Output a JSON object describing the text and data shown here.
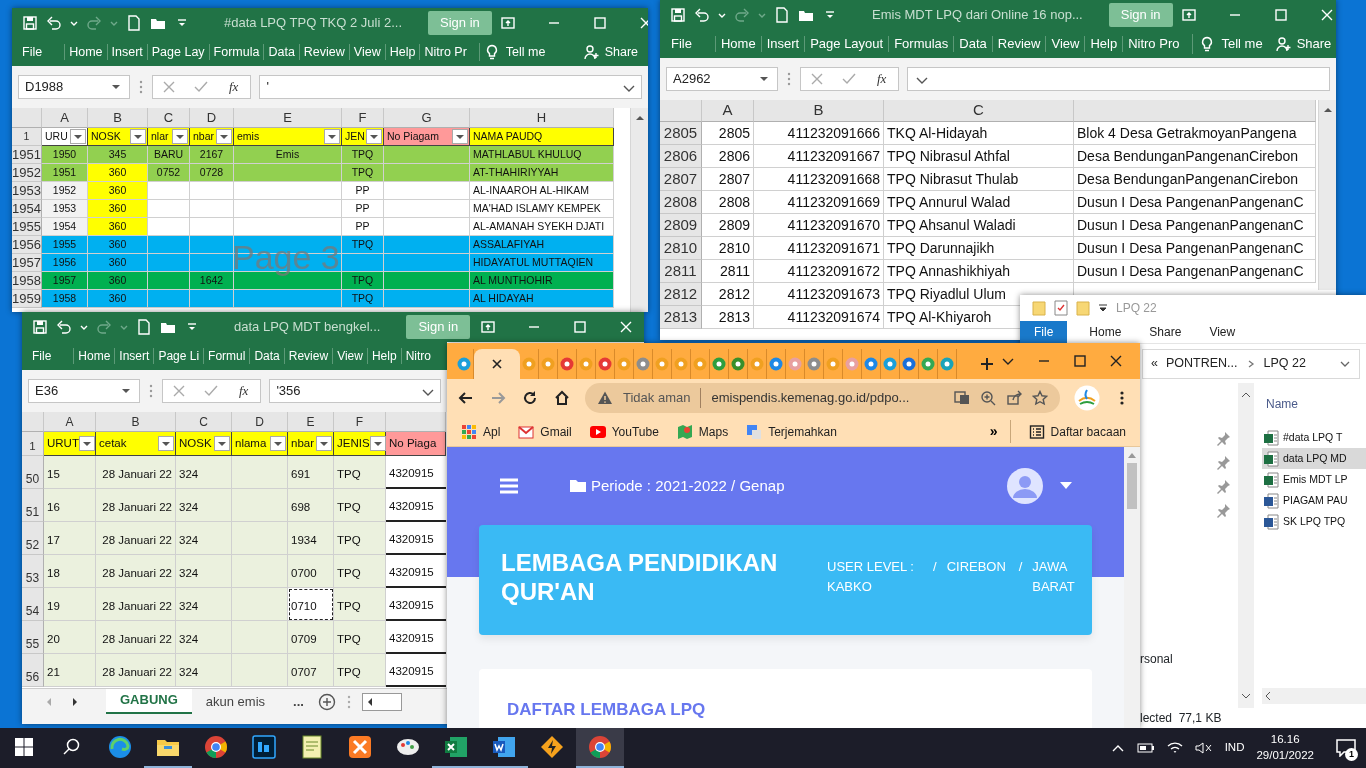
{
  "excel_windows": [
    {
      "title": "#data LPQ TPQ TKQ 2 Juli 2...",
      "sign_in": "Sign in",
      "ribbon_tabs": [
        "File",
        "Home",
        "Insert",
        "Page Lay",
        "Formula",
        "Data",
        "Review",
        "View",
        "Help",
        "Nitro Pr"
      ],
      "tell_me": "Tell me",
      "share": "Share",
      "name_box": "D1988",
      "function_button": "fx",
      "formula": "'",
      "columns": [
        "A",
        "B",
        "C",
        "D",
        "E",
        "F",
        "G",
        "H"
      ],
      "header": {
        "number": "1",
        "cells": [
          {
            "text": "URU",
            "color": "#ffffff",
            "filter": true
          },
          {
            "text": "NOSK",
            "color": "#ffff00",
            "filter": true
          },
          {
            "text": "nlar",
            "color": "#ffff00",
            "filter": true
          },
          {
            "text": "nbar",
            "color": "#ffff00",
            "filter": true
          },
          {
            "text": "emis",
            "color": "#ffff00",
            "filter": true
          },
          {
            "text": "JEN",
            "color": "#ffff00",
            "filter": true
          },
          {
            "text": "No Piagam",
            "color": "#ff9999",
            "filter": true
          },
          {
            "text": "NAMA PAUDQ",
            "color": "#ffff00",
            "filter": false
          }
        ]
      },
      "rows": [
        {
          "number": "1951",
          "color": "#92d050",
          "cells": [
            "1950",
            "345",
            "BARU",
            "2167",
            "Emis",
            "TPQ",
            null,
            "MATHLABUL KHULUQ"
          ]
        },
        {
          "number": "1952",
          "color": "#92d050",
          "cells": [
            "1951",
            {
              "text": "360",
              "color": "#ffff00"
            },
            "0752",
            "0728",
            null,
            "TPQ",
            null,
            "AT-THAHIRIYYAH"
          ]
        },
        {
          "number": "1953",
          "color": "#ffffff",
          "cells": [
            {
              "text": "1952",
              "color": "#f2f2f2"
            },
            {
              "text": "360",
              "color": "#ffff00"
            },
            null,
            null,
            null,
            "PP",
            null,
            "AL-INAAROH AL-HIKAM"
          ]
        },
        {
          "number": "1954",
          "color": "#ffffff",
          "cells": [
            {
              "text": "1953",
              "color": "#f2f2f2"
            },
            {
              "text": "360",
              "color": "#ffff00"
            },
            null,
            null,
            null,
            "PP",
            null,
            "MA'HAD ISLAMY KEMPEK"
          ]
        },
        {
          "number": "1955",
          "color": "#ffffff",
          "cells": [
            {
              "text": "1954",
              "color": "#f2f2f2"
            },
            {
              "text": "360",
              "color": "#ffff00"
            },
            null,
            null,
            null,
            "PP",
            null,
            "AL-AMANAH SYEKH DJATI"
          ]
        },
        {
          "number": "1956",
          "color": "#00b0f0",
          "cells": [
            "1955",
            "360",
            null,
            null,
            null,
            "TPQ",
            null,
            "ASSALAFIYAH"
          ]
        },
        {
          "number": "1957",
          "color": "#00b0f0",
          "cells": [
            "1956",
            "360",
            null,
            null,
            null,
            null,
            null,
            "HIDAYATUL MUTTAQIEN"
          ]
        },
        {
          "number": "1958",
          "color": "#00b050",
          "cells": [
            "1957",
            "360",
            null,
            "1642",
            null,
            "TPQ",
            null,
            "AL MUNTHOHIR"
          ]
        },
        {
          "number": "1959",
          "color": "#00b0f0",
          "cells": [
            "1958",
            "360",
            null,
            null,
            null,
            "TPQ",
            null,
            "AL HIDAYAH"
          ]
        }
      ],
      "page_label": "Page 3"
    },
    {
      "title": "Emis MDT LPQ dari Online 16 nop...",
      "sign_in": "Sign in",
      "ribbon_tabs": [
        "File",
        "Home",
        "Insert",
        "Page Layout",
        "Formulas",
        "Data",
        "Review",
        "View",
        "Help",
        "Nitro Pro"
      ],
      "tell_me": "Tell me",
      "share": "Share",
      "name_box": "A2962",
      "function_button": "fx",
      "columns": [
        "A",
        "B",
        "C"
      ],
      "rows": [
        {
          "number": "2805",
          "cells": [
            "2805",
            "411232091666",
            "TKQ Al-Hidayah",
            "Blok 4 Desa GetrakmoyanPangena"
          ]
        },
        {
          "number": "2806",
          "cells": [
            "2806",
            "411232091667",
            "TPQ Nibrasul Athfal",
            "Desa BendunganPangenanCirebon"
          ]
        },
        {
          "number": "2807",
          "cells": [
            "2807",
            "411232091668",
            "TPQ Nibrasut Thulab",
            "Desa BendunganPangenanCirebon"
          ]
        },
        {
          "number": "2808",
          "cells": [
            "2808",
            "411232091669",
            "TPQ Annurul Walad",
            "Dusun I Desa PangenanPangenanC"
          ]
        },
        {
          "number": "2809",
          "cells": [
            "2809",
            "411232091670",
            "TPQ Ahsanul Waladi",
            "Dusun I Desa PangenanPangenanC"
          ]
        },
        {
          "number": "2810",
          "cells": [
            "2810",
            "411232091671",
            "TPQ Darunnajikh",
            "Dusun I Desa PangenanPangenanC"
          ]
        },
        {
          "number": "2811",
          "cells": [
            "2811",
            "411232091672",
            "TPQ Annashikhiyah",
            "Dusun I Desa PangenanPangenanC"
          ]
        },
        {
          "number": "2812",
          "cells": [
            "2812",
            "411232091673",
            "TPQ Riyadlul Ulum"
          ]
        },
        {
          "number": "2813",
          "cells": [
            "2813",
            "411232091674",
            "TPQ Al-Khiyaroh"
          ]
        }
      ]
    },
    {
      "title": "data LPQ MDT bengkel...",
      "sign_in": "Sign in",
      "ribbon_tabs": [
        "File",
        "Home",
        "Insert",
        "Page Li",
        "Formul",
        "Data",
        "Review",
        "View",
        "Help",
        "Nitro"
      ],
      "name_box": "E36",
      "function_button": "fx",
      "formula": "'356",
      "columns": [
        "A",
        "B",
        "C",
        "D",
        "E",
        "F"
      ],
      "header": {
        "number": "1",
        "cells": [
          {
            "text": "URUT",
            "color": "#ffff00",
            "filter": true
          },
          {
            "text": "cetak",
            "color": "#ffff00",
            "filter": true
          },
          {
            "text": "NOSK",
            "color": "#ffff00",
            "filter": true
          },
          {
            "text": "nlama",
            "color": "#ffff00",
            "filter": true
          },
          {
            "text": "nbar",
            "color": "#ffff00",
            "filter": true
          },
          {
            "text": "JENIS",
            "color": "#ffff00",
            "filter": true
          },
          {
            "text": "No Piaga",
            "color": "#ff9999",
            "filter": false
          }
        ]
      },
      "rows": [
        {
          "number": "50",
          "cells": [
            "15",
            "28 Januari 22",
            "324",
            null,
            "691",
            "TPQ",
            "4320915"
          ]
        },
        {
          "number": "51",
          "cells": [
            "16",
            "28 Januari 22",
            "324",
            null,
            "698",
            "TPQ",
            "4320915"
          ]
        },
        {
          "number": "52",
          "cells": [
            "17",
            "28 Januari 22",
            "324",
            null,
            "1934",
            "TPQ",
            "4320915"
          ]
        },
        {
          "number": "53",
          "cells": [
            "18",
            "28 Januari 22",
            "324",
            null,
            "0700",
            "TPQ",
            "4320915"
          ]
        },
        {
          "number": "54",
          "cells": [
            "19",
            "28 Januari 22",
            "324",
            null,
            {
              "text": "0710",
              "marked": true
            },
            "TPQ",
            "4320915"
          ]
        },
        {
          "number": "55",
          "cells": [
            "20",
            "28 Januari 22",
            "324",
            null,
            "0709",
            "TPQ",
            "4320915"
          ]
        },
        {
          "number": "56",
          "cells": [
            "21",
            "28 Januari 22",
            "324",
            null,
            "0707",
            "TPQ",
            "4320915"
          ]
        }
      ],
      "sheet_tabs": [
        {
          "label": "GABUNG",
          "selected": true
        },
        {
          "label": "akun emis",
          "selected": false
        }
      ],
      "more_sheets": "..."
    }
  ],
  "browser": {
    "tabs": [
      {
        "color": "#1a9fd9",
        "selected": false
      },
      {
        "selected": true
      },
      {
        "color": "#f0a020",
        "selected": false
      },
      {
        "color": "#f0a020",
        "selected": false
      },
      {
        "color": "#e53935",
        "selected": false
      },
      {
        "color": "#f0a020",
        "selected": false
      },
      {
        "color": "#e53935",
        "selected": false
      },
      {
        "color": "#f0a020",
        "selected": false
      },
      {
        "color": "#8d8d8d",
        "selected": false
      },
      {
        "color": "#f0a020",
        "selected": false
      },
      {
        "color": "#f0a020",
        "selected": false
      },
      {
        "color": "#f0a020",
        "selected": false
      },
      {
        "color": "#2e9e3e",
        "selected": false
      },
      {
        "color": "#3a8f2a",
        "selected": false
      },
      {
        "color": "#f0a020",
        "selected": false
      },
      {
        "color": "#1e88e5",
        "selected": false
      },
      {
        "color": "#e8a0a0",
        "selected": false
      },
      {
        "color": "#8d8d8d",
        "selected": false
      },
      {
        "color": "#f0a020",
        "selected": false
      },
      {
        "color": "#e8a0a0",
        "selected": false
      },
      {
        "color": "#1e88e5",
        "selected": false
      },
      {
        "color": "#1a9fd9",
        "selected": false
      },
      {
        "color": "#1a6fd9",
        "selected": false
      },
      {
        "color": "#34a853",
        "selected": false
      },
      {
        "color": "#1aa3b9",
        "selected": false
      }
    ],
    "security": "Tidak aman",
    "url": "emispendis.kemenag.go.id/pdpo...",
    "bookmarks": [
      {
        "kind": "apps",
        "label": "Apl"
      },
      {
        "kind": "mail",
        "label": "Gmail"
      },
      {
        "kind": "video",
        "label": "YouTube"
      },
      {
        "kind": "map",
        "label": "Maps"
      },
      {
        "kind": "translate",
        "label": "Terjemahkan"
      }
    ],
    "more_bookmarks": "»",
    "reading_list": "Daftar bacaan",
    "page": {
      "period": "Periode : 2021-2022 / Genap",
      "heading": "LEMBAGA PENDIDIKAN QUR'AN",
      "breadcrumb": [
        {
          "label": "USER LEVEL : KABKO"
        },
        {
          "separator": "/",
          "label": "CIREBON"
        },
        {
          "separator": "/",
          "label": "JAWA BARAT"
        }
      ],
      "section_title": "DAFTAR LEMBAGA LPQ"
    }
  },
  "explorer": {
    "title": "LPQ 22",
    "ribbon_tabs": [
      {
        "label": "File",
        "selected": true
      },
      {
        "label": "Home",
        "selected": false
      },
      {
        "label": "Share",
        "selected": false
      },
      {
        "label": "View",
        "selected": false
      }
    ],
    "path_prefix": "«",
    "path": [
      "PONTREN...",
      "LPQ 22"
    ],
    "column": "Name",
    "files": [
      {
        "name": "#data LPQ T",
        "kind": "excel",
        "selected": false
      },
      {
        "name": "data LPQ MD",
        "kind": "excel",
        "selected": true
      },
      {
        "name": "Emis MDT LP",
        "kind": "excel",
        "selected": false
      },
      {
        "name": "PIAGAM PAU",
        "kind": "word",
        "selected": false
      },
      {
        "name": "SK LPQ TPQ",
        "kind": "word",
        "selected": false
      }
    ],
    "nav_item": "rsonal",
    "status": "lected  77,1 KB"
  },
  "taskbar": {
    "apps": [
      {
        "kind": "edge",
        "running": false,
        "selected": false
      },
      {
        "kind": "folder",
        "running": true,
        "selected": false
      },
      {
        "kind": "chrome",
        "running": false,
        "selected": false
      },
      {
        "kind": "photoshop",
        "running": false,
        "selected": false
      },
      {
        "kind": "notepad",
        "running": false,
        "selected": false
      },
      {
        "kind": "xampp",
        "running": false,
        "selected": false
      },
      {
        "kind": "paint",
        "running": false,
        "selected": false
      },
      {
        "kind": "excel",
        "running": true,
        "selected": false
      },
      {
        "kind": "word",
        "running": true,
        "selected": false
      },
      {
        "kind": "bolt",
        "running": false,
        "selected": false
      },
      {
        "kind": "chrome",
        "running": true,
        "selected": true
      }
    ],
    "language": "IND",
    "time": "16.16",
    "date": "29/01/2022",
    "notifications": "1"
  }
}
